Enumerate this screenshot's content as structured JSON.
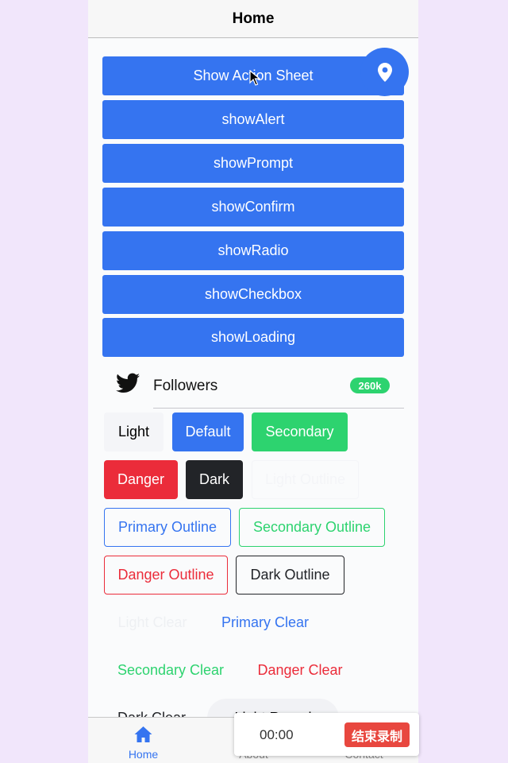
{
  "header": {
    "title": "Home"
  },
  "actions": [
    "Show Action Sheet",
    "showAlert",
    "showPrompt",
    "showConfirm",
    "showRadio",
    "showCheckbox",
    "showLoading"
  ],
  "followers_item": {
    "label": "Followers",
    "badge": "260k",
    "icon": "twitter-icon"
  },
  "buttons": {
    "light": "Light",
    "default": "Default",
    "secondary": "Secondary",
    "danger": "Danger",
    "dark": "Dark",
    "light_outline": "Light Outline",
    "primary_outline": "Primary Outline",
    "secondary_outline": "Secondary Outline",
    "danger_outline": "Danger Outline",
    "dark_outline": "Dark Outline",
    "light_clear": "Light Clear",
    "primary_clear": "Primary Clear",
    "secondary_clear": "Secondary Clear",
    "danger_clear": "Danger Clear",
    "dark_clear": "Dark Clear",
    "light_round": "Light Round"
  },
  "tabs": [
    {
      "label": "Home",
      "icon": "home-icon",
      "active": true
    },
    {
      "label": "About",
      "icon": "info-icon",
      "active": false
    },
    {
      "label": "Contact",
      "icon": "contact-icon",
      "active": false
    }
  ],
  "recorder": {
    "time": "00:00",
    "stop_label": "结束录制"
  },
  "colors": {
    "primary": "#3574f0",
    "secondary": "#2dd36f",
    "danger": "#eb2c3a",
    "dark": "#222428",
    "light": "#f4f5f8"
  }
}
